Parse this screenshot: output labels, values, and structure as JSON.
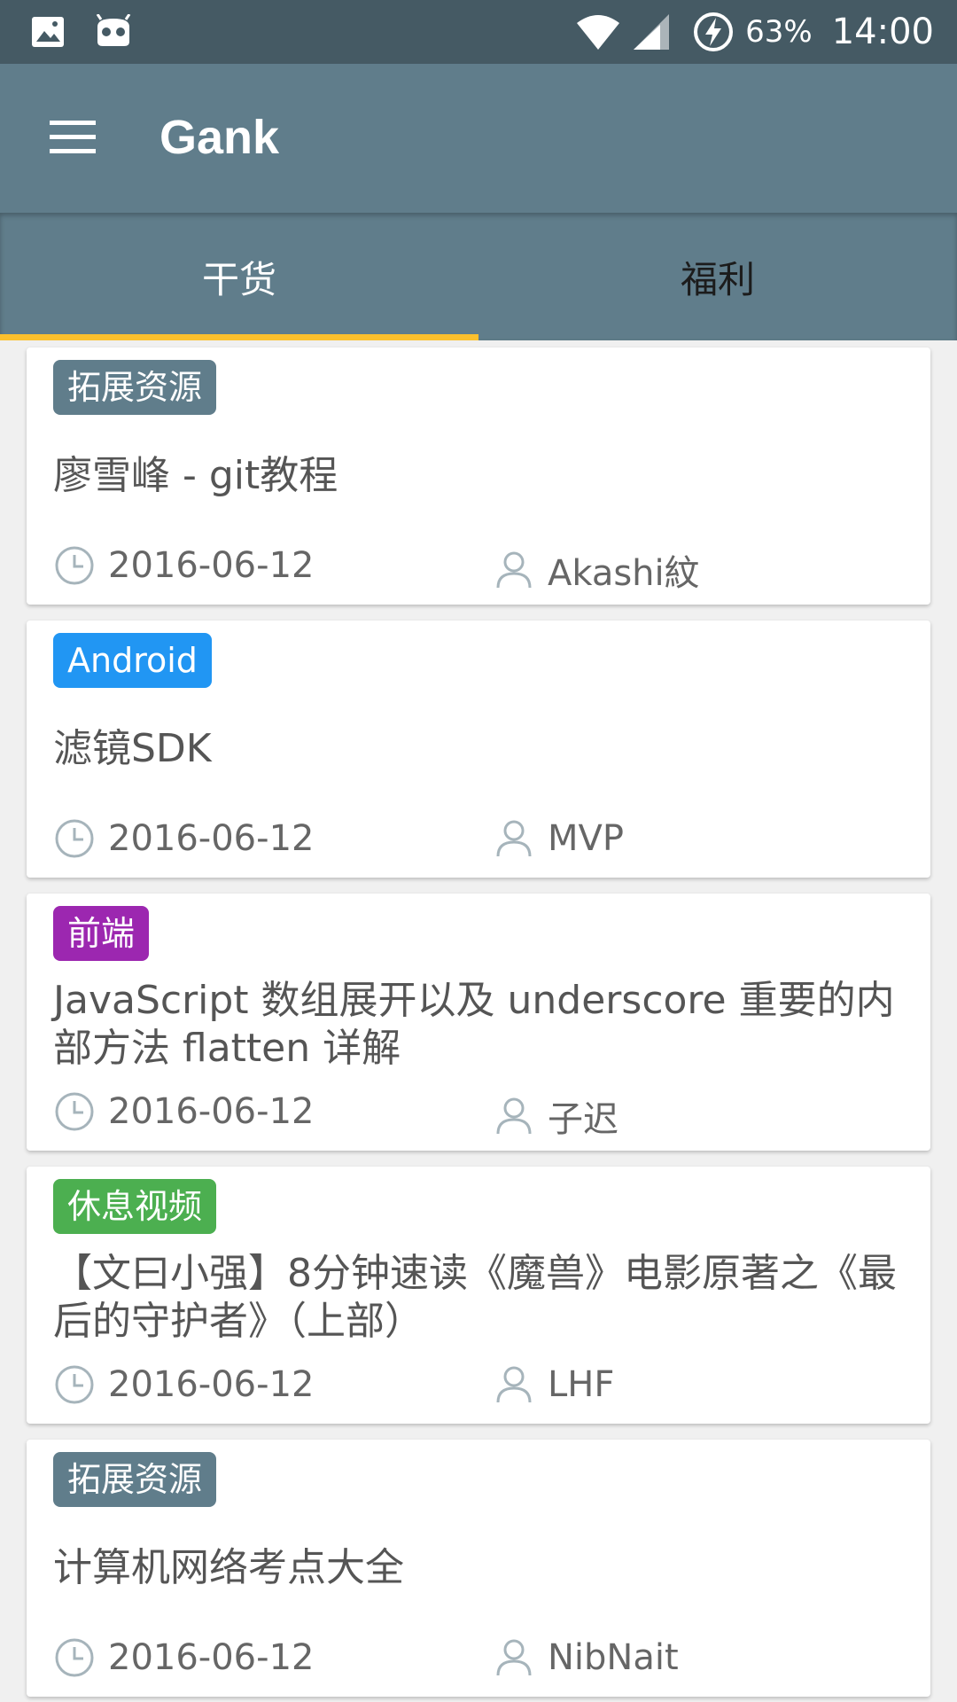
{
  "status_bar": {
    "battery": "63%",
    "time": "14:00"
  },
  "toolbar": {
    "title": "Gank"
  },
  "tabs": [
    {
      "label": "干货",
      "active": true
    },
    {
      "label": "福利",
      "active": false
    }
  ],
  "colors": {
    "status_bar": "#455a64",
    "primary": "#607d8b",
    "indicator": "#fbc02d",
    "tag_extension": "#607d8b",
    "tag_android": "#2196f3",
    "tag_frontend": "#9c27b0",
    "tag_video": "#4caf50"
  },
  "items": [
    {
      "tag": "拓展资源",
      "title": "廖雪峰 - git教程",
      "date": "2016-06-12",
      "author": "Akashi紋"
    },
    {
      "tag": "Android",
      "title": "滤镜SDK",
      "date": "2016-06-12",
      "author": "MVP"
    },
    {
      "tag": "前端",
      "title": "JavaScript 数组展开以及 underscore 重要的内部方法 flatten 详解",
      "date": "2016-06-12",
      "author": "子迟"
    },
    {
      "tag": "休息视频",
      "title": "【文曰小强】8分钟速读《魔兽》电影原著之《最后的守护者》（上部）",
      "date": "2016-06-12",
      "author": "LHF"
    },
    {
      "tag": "拓展资源",
      "title": "计算机网络考点大全",
      "date": "2016-06-12",
      "author": "NibNait"
    }
  ]
}
